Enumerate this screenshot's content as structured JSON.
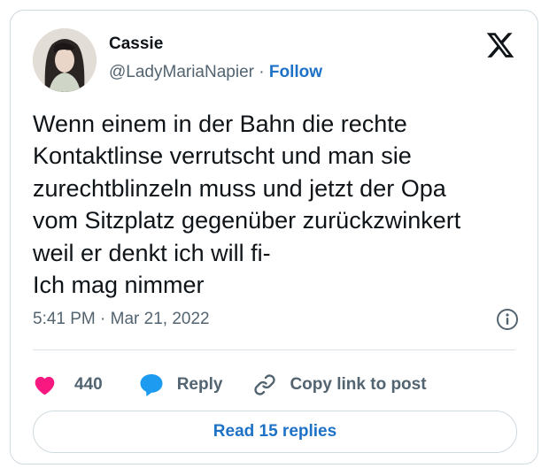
{
  "author": {
    "name": "Cassie",
    "handle": "@LadyMariaNapier",
    "separator": "·",
    "follow_label": "Follow"
  },
  "tweet": {
    "lines": [
      "Wenn einem in der Bahn die rechte",
      "Kontaktlinse verrutscht und man sie",
      "zurechtblinzeln muss und jetzt der Opa",
      "vom Sitzplatz gegenüber zurückzwinkert",
      "weil er denkt ich will fi-",
      "Ich mag nimmer"
    ],
    "time": "5:41 PM",
    "date_separator": "·",
    "date": "Mar 21, 2022"
  },
  "actions": {
    "like_count": "440",
    "reply_label": "Reply",
    "copy_link_label": "Copy link to post"
  },
  "footer": {
    "read_replies_label": "Read 15 replies"
  },
  "icons": {
    "logo": "x-logo-icon",
    "info": "info-icon",
    "like": "heart-icon",
    "reply": "speech-bubble-icon",
    "copy_link": "link-icon"
  },
  "colors": {
    "accent": "#1d72c7",
    "heart": "#f91880",
    "secondary_text": "#536471",
    "border": "#cfd9de"
  }
}
